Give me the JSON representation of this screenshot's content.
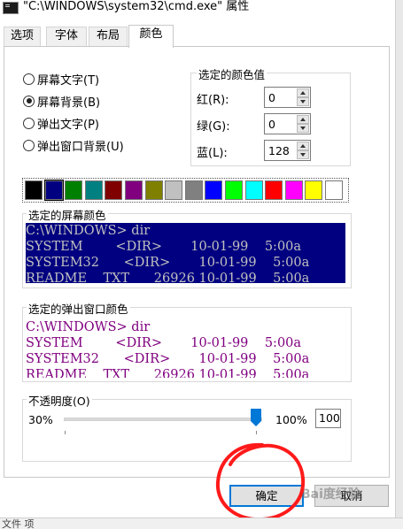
{
  "window": {
    "title": "\"C:\\WINDOWS\\system32\\cmd.exe\" 属性"
  },
  "tabs": [
    {
      "label": "选项",
      "active": false
    },
    {
      "label": "字体",
      "active": false
    },
    {
      "label": "布局",
      "active": false
    },
    {
      "label": "颜色",
      "active": true
    }
  ],
  "radios": [
    {
      "label": "屏幕文字(T)",
      "checked": false
    },
    {
      "label": "屏幕背景(B)",
      "checked": true
    },
    {
      "label": "弹出文字(P)",
      "checked": false
    },
    {
      "label": "弹出窗口背景(U)",
      "checked": false
    }
  ],
  "color_values": {
    "group_label": "选定的颜色值",
    "red": {
      "label": "红(R):",
      "value": "0"
    },
    "green": {
      "label": "绿(G):",
      "value": "0"
    },
    "blue": {
      "label": "蓝(L):",
      "value": "128"
    }
  },
  "palette": {
    "colors": [
      "#000000",
      "#000080",
      "#008000",
      "#008080",
      "#800000",
      "#800080",
      "#808000",
      "#c0c0c0",
      "#808080",
      "#0000ff",
      "#00ff00",
      "#00ffff",
      "#ff0000",
      "#ff00ff",
      "#ffff00",
      "#ffffff"
    ],
    "selected_index": 1
  },
  "screen_preview": {
    "label": "选定的屏幕颜色",
    "bg": "#000080",
    "prompt_color": "#c0c0c0",
    "text_color": "#c0c0c0",
    "lines": [
      "C:\\WINDOWS> dir",
      "SYSTEM        <DIR>       10-01-99    5:00a",
      "SYSTEM32      <DIR>       10-01-99    5:00a",
      "README    TXT      26926 10-01-99    5:00a"
    ]
  },
  "popup_preview": {
    "label": "选定的弹出窗口颜色",
    "bg": "#ffffff",
    "text_color": "#800080",
    "lines": [
      "C:\\WINDOWS> dir",
      "SYSTEM        <DIR>       10-01-99    5:00a",
      "SYSTEM32      <DIR>       10-01-99    5:00a",
      "README    TXT      26926 10-01-99    5:00a"
    ]
  },
  "opacity": {
    "group_label": "不透明度(O)",
    "min_label": "30%",
    "max_label": "100%",
    "value": "100",
    "level_fraction": 1.0
  },
  "buttons": {
    "ok": "确定",
    "cancel": "取消"
  },
  "watermark": "Bai度经验",
  "statusbar": {
    "text": "文件 项"
  },
  "colors": {
    "accent": "#0078d7",
    "annotation_red": "#ff1a1a"
  }
}
